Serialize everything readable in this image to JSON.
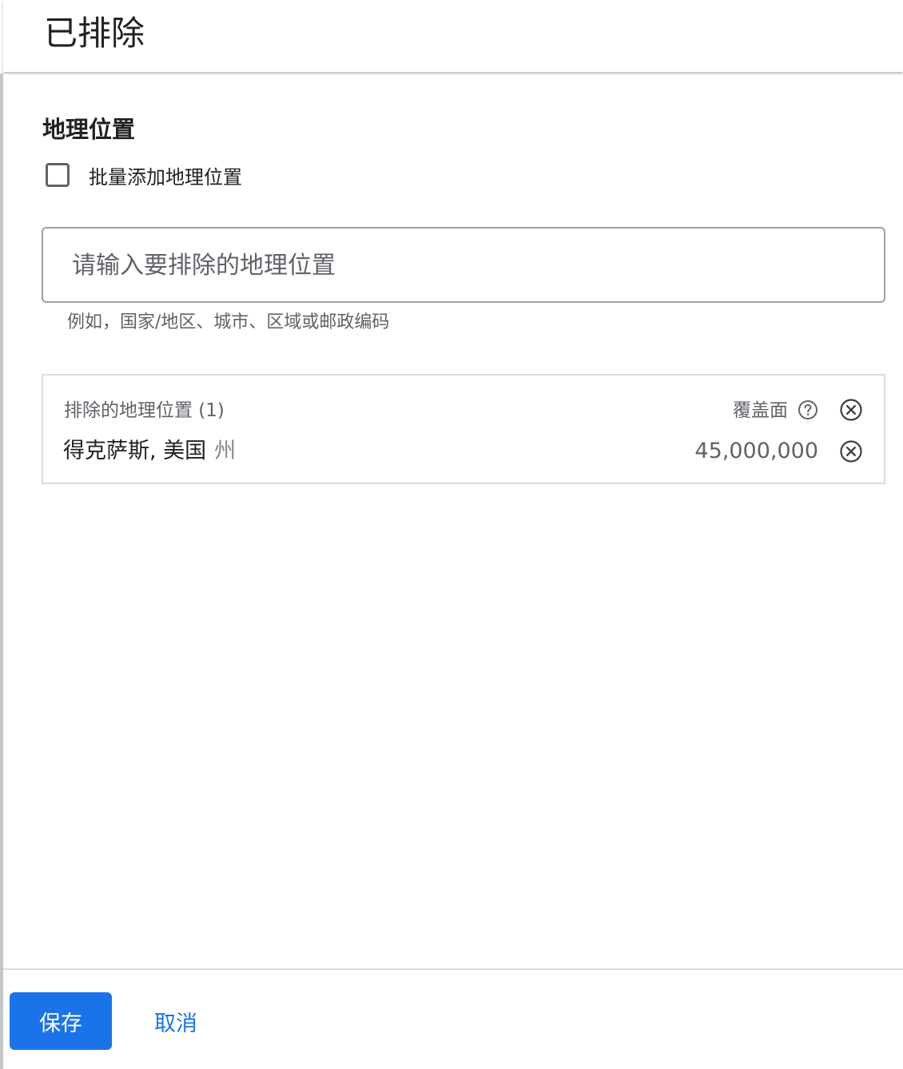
{
  "header": {
    "title": "已排除"
  },
  "geo": {
    "section_title": "地理位置",
    "bulk_add_label": "批量添加地理位置",
    "bulk_add_checked": false,
    "search": {
      "placeholder": "请输入要排除的地理位置",
      "value": ""
    },
    "hint": "例如，国家/地区、城市、区域或邮政编码"
  },
  "excluded_list": {
    "header_label": "排除的地理位置 (1)",
    "coverage_label": "覆盖面",
    "items": [
      {
        "name": "得克萨斯, 美国",
        "type": "州",
        "reach": "45,000,000"
      }
    ]
  },
  "footer": {
    "save_label": "保存",
    "cancel_label": "取消"
  },
  "colors": {
    "accent": "#1a73e8",
    "text_primary": "#202124",
    "text_secondary": "#5f6368",
    "border": "#dadce0"
  },
  "icons": {
    "help": "help-circle-icon",
    "clear_all": "close-circle-icon",
    "remove": "close-circle-icon"
  }
}
